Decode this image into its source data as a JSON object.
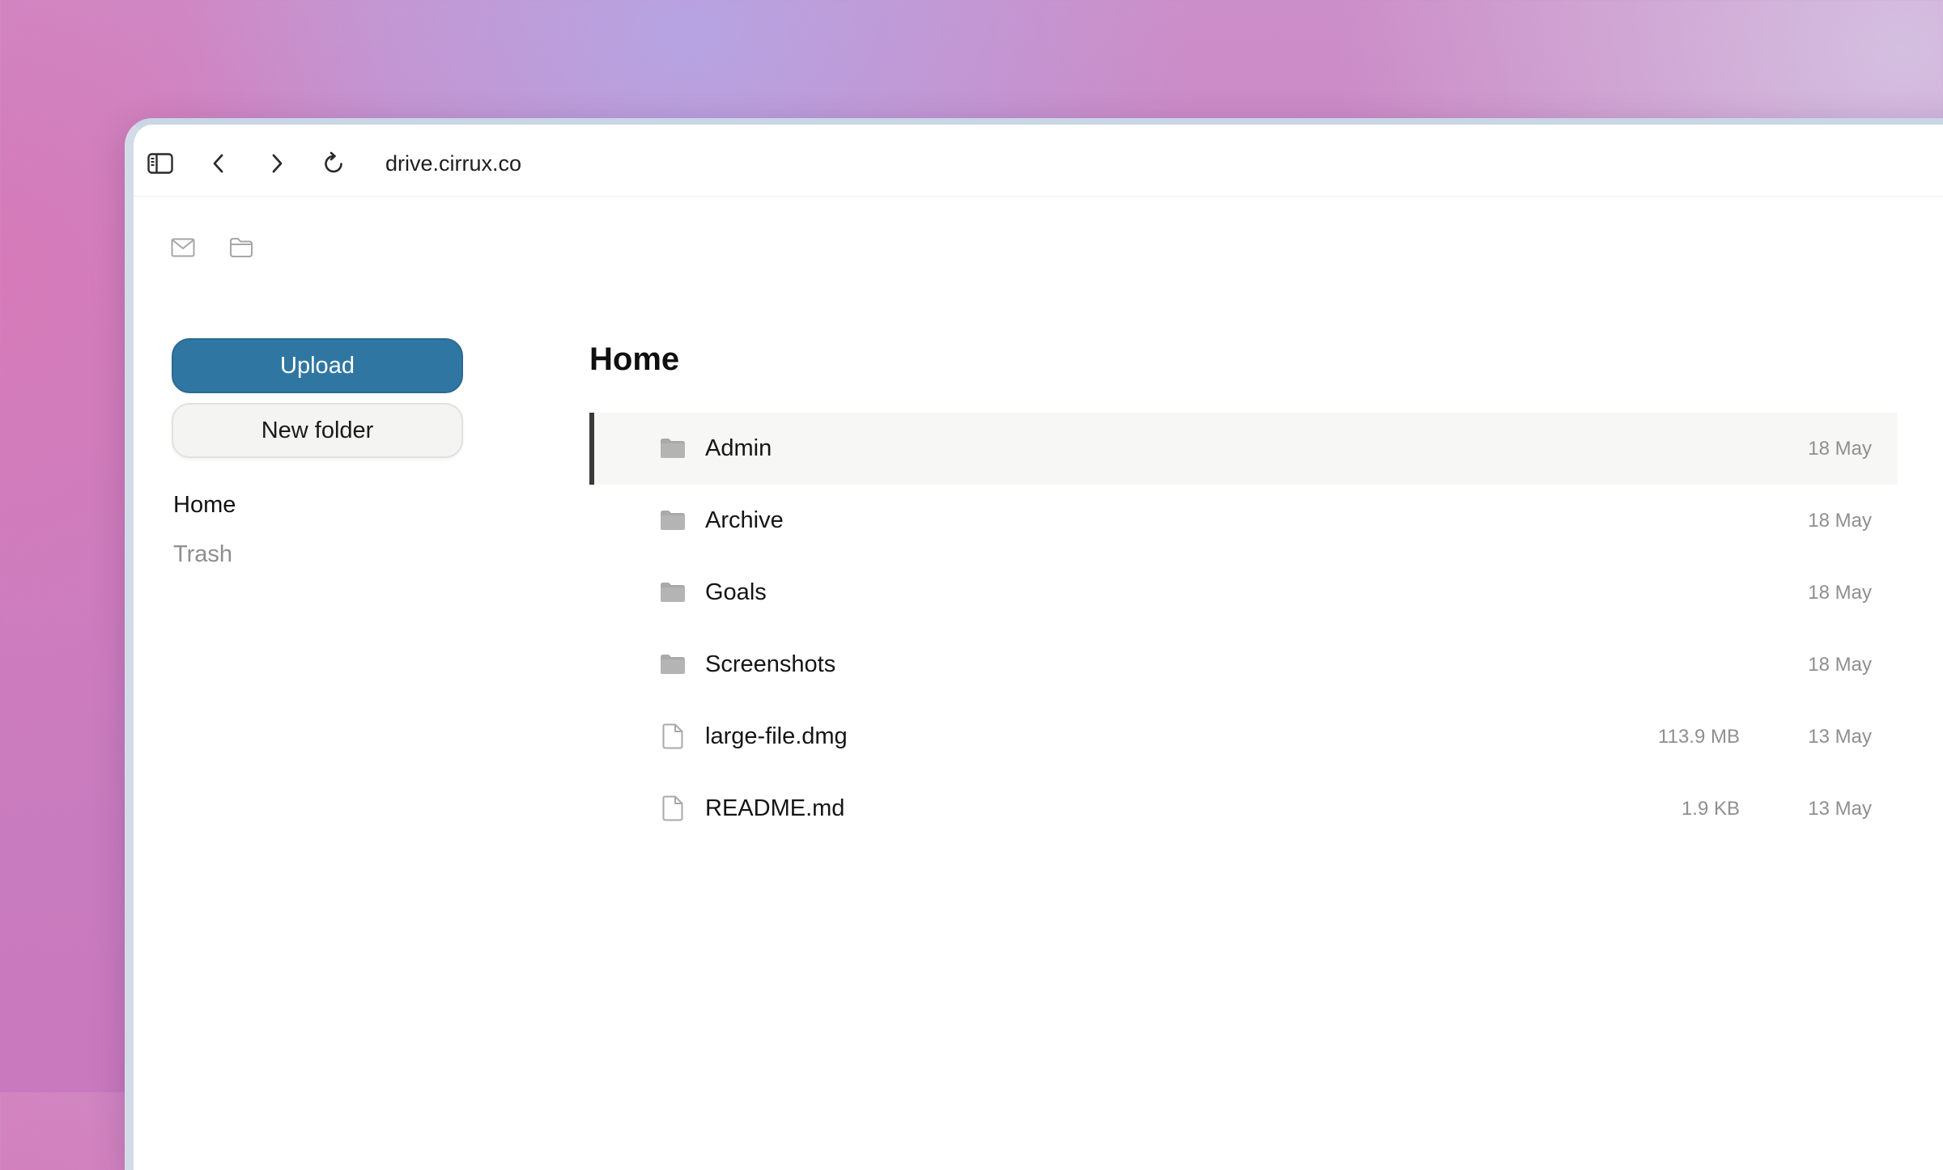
{
  "browser": {
    "url": "drive.cirrux.co"
  },
  "sidebar": {
    "upload_label": "Upload",
    "new_folder_label": "New folder",
    "nav": [
      {
        "label": "Home",
        "active": true
      },
      {
        "label": "Trash",
        "active": false
      }
    ]
  },
  "main": {
    "title": "Home",
    "files": [
      {
        "type": "folder",
        "name": "Admin",
        "size": "",
        "date": "18 May",
        "selected": true
      },
      {
        "type": "folder",
        "name": "Archive",
        "size": "",
        "date": "18 May",
        "selected": false
      },
      {
        "type": "folder",
        "name": "Goals",
        "size": "",
        "date": "18 May",
        "selected": false
      },
      {
        "type": "folder",
        "name": "Screenshots",
        "size": "",
        "date": "18 May",
        "selected": false
      },
      {
        "type": "file",
        "name": "large-file.dmg",
        "size": "113.9 MB",
        "date": "13 May",
        "selected": false
      },
      {
        "type": "file",
        "name": "README.md",
        "size": "1.9 KB",
        "date": "13 May",
        "selected": false
      }
    ]
  },
  "colors": {
    "upload_button": "#2f77a2",
    "selected_row_bg": "#f7f7f6",
    "selected_row_marker": "#3a3a3a",
    "muted_text": "#8f8f8f"
  },
  "icons": {
    "toolbar": [
      "sidebar-toggle-icon",
      "back-icon",
      "forward-icon",
      "reload-icon"
    ],
    "app": [
      "mail-icon",
      "folder-outline-icon"
    ],
    "folder": "folder-icon",
    "file": "file-icon"
  }
}
